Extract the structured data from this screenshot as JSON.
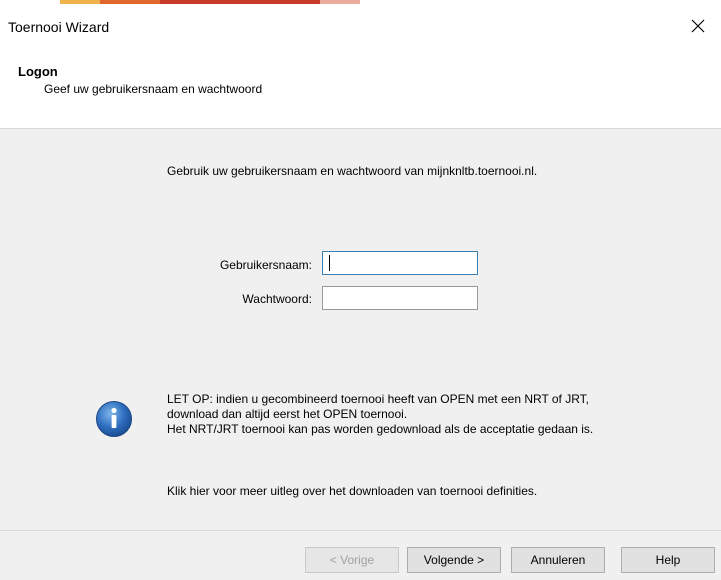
{
  "window": {
    "title": "Toernooi Wizard",
    "close_icon": "close-icon"
  },
  "header": {
    "title": "Logon",
    "subtitle": "Geef uw gebruikersnaam en wachtwoord"
  },
  "main": {
    "intro": "Gebruik uw gebruikersnaam en wachtwoord van mijnknltb.toernooi.nl.",
    "username_label": "Gebruikersnaam:",
    "username_value": "",
    "password_label": "Wachtwoord:",
    "password_value": "",
    "info_icon": "info-icon",
    "note_line1": "LET OP: indien u gecombineerd toernooi heeft van OPEN met een NRT of JRT, download dan altijd eerst het OPEN toernooi.",
    "note_line2": "Het NRT/JRT toernooi kan pas worden gedownload als de acceptatie gedaan is.",
    "help_link": "Klik hier voor meer uitleg over het downloaden van toernooi definities."
  },
  "footer": {
    "back_label": "< Vorige",
    "next_label": "Volgende >",
    "cancel_label": "Annuleren",
    "help_label": "Help"
  },
  "colors": {
    "accent_strip": [
      "#e8a33a",
      "#d9562b",
      "#c0392b"
    ],
    "panel_background": "#f0f0f0",
    "focus_border": "#3c7fb1"
  }
}
